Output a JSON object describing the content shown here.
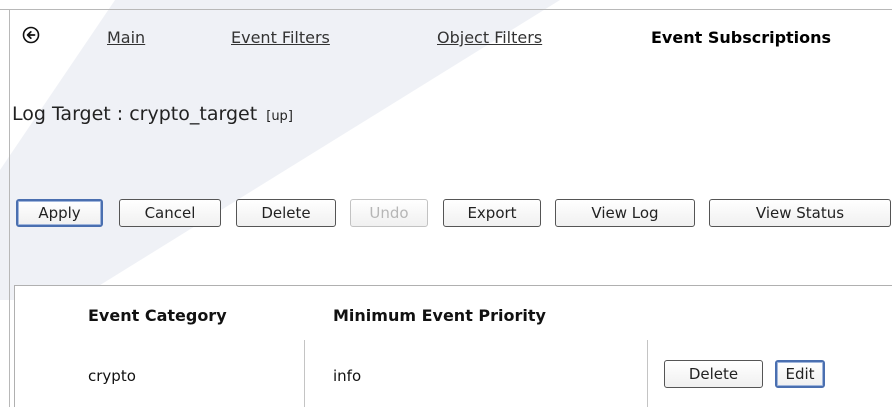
{
  "tabs": {
    "main": "Main",
    "event_filters": "Event Filters",
    "object_filters": "Object Filters",
    "event_subscriptions": "Event Subscriptions"
  },
  "title": {
    "label": "Log Target : crypto_target",
    "status": "[up]"
  },
  "toolbar": {
    "apply": "Apply",
    "cancel": "Cancel",
    "delete": "Delete",
    "undo": "Undo",
    "export": "Export",
    "view_log": "View Log",
    "view_status": "View Status"
  },
  "table": {
    "headers": [
      "Event Category",
      "Minimum Event Priority"
    ],
    "rows": [
      {
        "category": "crypto",
        "priority": "info",
        "delete_label": "Delete",
        "edit_label": "Edit"
      }
    ]
  },
  "icons": {
    "back": "back-arrow-icon"
  },
  "colors": {
    "default_button_border": "#4a6fb0",
    "disabled_text": "#b6b6b6"
  }
}
